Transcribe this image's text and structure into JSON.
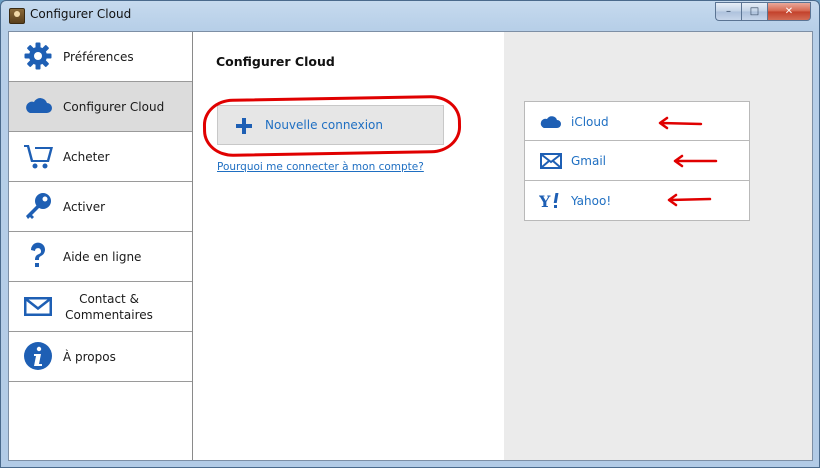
{
  "window": {
    "title": "Configurer Cloud",
    "minimize": "–",
    "maximize": "□",
    "close": "✕"
  },
  "sidebar": {
    "items": [
      {
        "label": "Préférences",
        "icon": "gear-icon"
      },
      {
        "label": "Configurer Cloud",
        "icon": "cloud-icon",
        "active": true
      },
      {
        "label": "Acheter",
        "icon": "cart-icon"
      },
      {
        "label": "Activer",
        "icon": "key-icon"
      },
      {
        "label": "Aide en ligne",
        "icon": "question-icon"
      },
      {
        "label_line1": "Contact &",
        "label_line2": "Commentaires",
        "icon": "envelope-icon"
      },
      {
        "label": "À propos",
        "icon": "info-icon"
      }
    ]
  },
  "main": {
    "title": "Configurer Cloud",
    "new_connection_label": "Nouvelle connexion",
    "help_link": "Pourquoi me connecter à mon compte?"
  },
  "providers": [
    {
      "label": "iCloud",
      "icon": "cloud-icon"
    },
    {
      "label": "Gmail",
      "icon": "envelope-icon"
    },
    {
      "label": "Yahoo!",
      "icon": "yahoo-icon"
    }
  ],
  "colors": {
    "accent": "#1f6fc2",
    "icon_blue": "#1e5fb4",
    "annotation": "#e00000",
    "active_bg": "#dcdcdc"
  }
}
